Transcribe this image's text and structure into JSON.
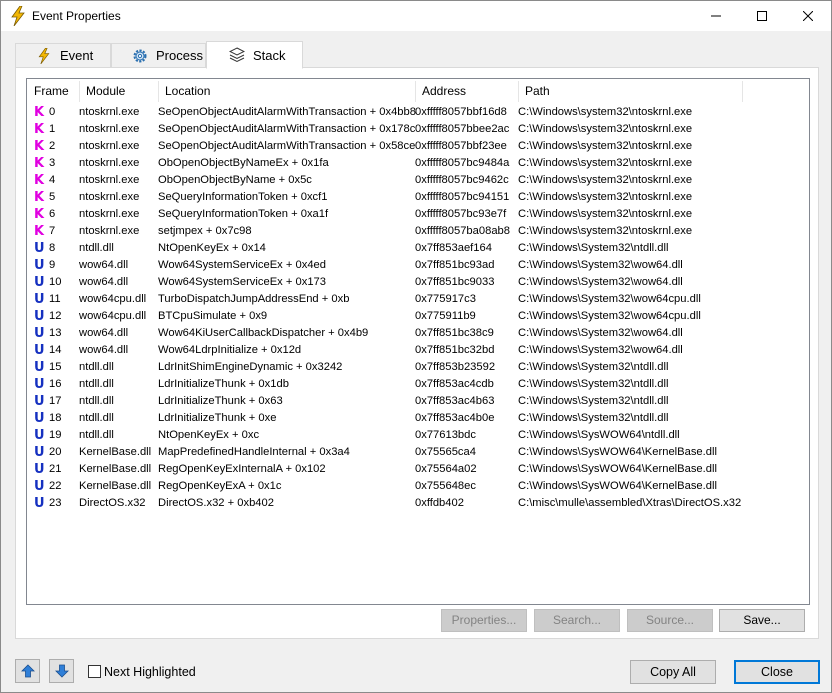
{
  "window": {
    "title": "Event Properties"
  },
  "tabs": [
    {
      "label": "Event",
      "icon": "lightning-icon"
    },
    {
      "label": "Process",
      "icon": "gear-icon"
    },
    {
      "label": "Stack",
      "icon": "stack-layers-icon",
      "active": true
    }
  ],
  "stack_table": {
    "columns": [
      "Frame",
      "Module",
      "Location",
      "Address",
      "Path"
    ],
    "rows": [
      {
        "kind": "K",
        "frame": "0",
        "module": "ntoskrnl.exe",
        "location": "SeOpenObjectAuditAlarmWithTransaction + 0x4bb8",
        "address": "0xfffff8057bbf16d8",
        "path": "C:\\Windows\\system32\\ntoskrnl.exe"
      },
      {
        "kind": "K",
        "frame": "1",
        "module": "ntoskrnl.exe",
        "location": "SeOpenObjectAuditAlarmWithTransaction + 0x178c",
        "address": "0xfffff8057bbee2ac",
        "path": "C:\\Windows\\system32\\ntoskrnl.exe"
      },
      {
        "kind": "K",
        "frame": "2",
        "module": "ntoskrnl.exe",
        "location": "SeOpenObjectAuditAlarmWithTransaction + 0x58ce",
        "address": "0xfffff8057bbf23ee",
        "path": "C:\\Windows\\system32\\ntoskrnl.exe"
      },
      {
        "kind": "K",
        "frame": "3",
        "module": "ntoskrnl.exe",
        "location": "ObOpenObjectByNameEx + 0x1fa",
        "address": "0xfffff8057bc9484a",
        "path": "C:\\Windows\\system32\\ntoskrnl.exe"
      },
      {
        "kind": "K",
        "frame": "4",
        "module": "ntoskrnl.exe",
        "location": "ObOpenObjectByName + 0x5c",
        "address": "0xfffff8057bc9462c",
        "path": "C:\\Windows\\system32\\ntoskrnl.exe"
      },
      {
        "kind": "K",
        "frame": "5",
        "module": "ntoskrnl.exe",
        "location": "SeQueryInformationToken + 0xcf1",
        "address": "0xfffff8057bc94151",
        "path": "C:\\Windows\\system32\\ntoskrnl.exe"
      },
      {
        "kind": "K",
        "frame": "6",
        "module": "ntoskrnl.exe",
        "location": "SeQueryInformationToken + 0xa1f",
        "address": "0xfffff8057bc93e7f",
        "path": "C:\\Windows\\system32\\ntoskrnl.exe"
      },
      {
        "kind": "K",
        "frame": "7",
        "module": "ntoskrnl.exe",
        "location": "setjmpex + 0x7c98",
        "address": "0xfffff8057ba08ab8",
        "path": "C:\\Windows\\system32\\ntoskrnl.exe"
      },
      {
        "kind": "U",
        "frame": "8",
        "module": "ntdll.dll",
        "location": "NtOpenKeyEx + 0x14",
        "address": "0x7ff853aef164",
        "path": "C:\\Windows\\System32\\ntdll.dll"
      },
      {
        "kind": "U",
        "frame": "9",
        "module": "wow64.dll",
        "location": "Wow64SystemServiceEx + 0x4ed",
        "address": "0x7ff851bc93ad",
        "path": "C:\\Windows\\System32\\wow64.dll"
      },
      {
        "kind": "U",
        "frame": "10",
        "module": "wow64.dll",
        "location": "Wow64SystemServiceEx + 0x173",
        "address": "0x7ff851bc9033",
        "path": "C:\\Windows\\System32\\wow64.dll"
      },
      {
        "kind": "U",
        "frame": "11",
        "module": "wow64cpu.dll",
        "location": "TurboDispatchJumpAddressEnd + 0xb",
        "address": "0x775917c3",
        "path": "C:\\Windows\\System32\\wow64cpu.dll"
      },
      {
        "kind": "U",
        "frame": "12",
        "module": "wow64cpu.dll",
        "location": "BTCpuSimulate + 0x9",
        "address": "0x775911b9",
        "path": "C:\\Windows\\System32\\wow64cpu.dll"
      },
      {
        "kind": "U",
        "frame": "13",
        "module": "wow64.dll",
        "location": "Wow64KiUserCallbackDispatcher + 0x4b9",
        "address": "0x7ff851bc38c9",
        "path": "C:\\Windows\\System32\\wow64.dll"
      },
      {
        "kind": "U",
        "frame": "14",
        "module": "wow64.dll",
        "location": "Wow64LdrpInitialize + 0x12d",
        "address": "0x7ff851bc32bd",
        "path": "C:\\Windows\\System32\\wow64.dll"
      },
      {
        "kind": "U",
        "frame": "15",
        "module": "ntdll.dll",
        "location": "LdrInitShimEngineDynamic + 0x3242",
        "address": "0x7ff853b23592",
        "path": "C:\\Windows\\System32\\ntdll.dll"
      },
      {
        "kind": "U",
        "frame": "16",
        "module": "ntdll.dll",
        "location": "LdrInitializeThunk + 0x1db",
        "address": "0x7ff853ac4cdb",
        "path": "C:\\Windows\\System32\\ntdll.dll"
      },
      {
        "kind": "U",
        "frame": "17",
        "module": "ntdll.dll",
        "location": "LdrInitializeThunk + 0x63",
        "address": "0x7ff853ac4b63",
        "path": "C:\\Windows\\System32\\ntdll.dll"
      },
      {
        "kind": "U",
        "frame": "18",
        "module": "ntdll.dll",
        "location": "LdrInitializeThunk + 0xe",
        "address": "0x7ff853ac4b0e",
        "path": "C:\\Windows\\System32\\ntdll.dll"
      },
      {
        "kind": "U",
        "frame": "19",
        "module": "ntdll.dll",
        "location": "NtOpenKeyEx + 0xc",
        "address": "0x77613bdc",
        "path": "C:\\Windows\\SysWOW64\\ntdll.dll"
      },
      {
        "kind": "U",
        "frame": "20",
        "module": "KernelBase.dll",
        "location": "MapPredefinedHandleInternal + 0x3a4",
        "address": "0x75565ca4",
        "path": "C:\\Windows\\SysWOW64\\KernelBase.dll"
      },
      {
        "kind": "U",
        "frame": "21",
        "module": "KernelBase.dll",
        "location": "RegOpenKeyExInternalA + 0x102",
        "address": "0x75564a02",
        "path": "C:\\Windows\\SysWOW64\\KernelBase.dll"
      },
      {
        "kind": "U",
        "frame": "22",
        "module": "KernelBase.dll",
        "location": "RegOpenKeyExA + 0x1c",
        "address": "0x755648ec",
        "path": "C:\\Windows\\SysWOW64\\KernelBase.dll"
      },
      {
        "kind": "U",
        "frame": "23",
        "module": "DirectOS.x32",
        "location": "DirectOS.x32 + 0xb402",
        "address": "0xffdb402",
        "path": "C:\\misc\\mulle\\assembled\\Xtras\\DirectOS.x32"
      }
    ]
  },
  "panel_buttons": {
    "properties": "Properties...",
    "search": "Search...",
    "source": "Source...",
    "save": "Save..."
  },
  "footer": {
    "next_highlighted_label": "Next Highlighted",
    "next_highlighted_checked": false,
    "copy_all": "Copy All",
    "close": "Close"
  },
  "colors": {
    "kernel_frame": "#e000e0",
    "user_frame": "#1530c0",
    "focus_border": "#0078d7",
    "title_icon": "#f2b705"
  }
}
